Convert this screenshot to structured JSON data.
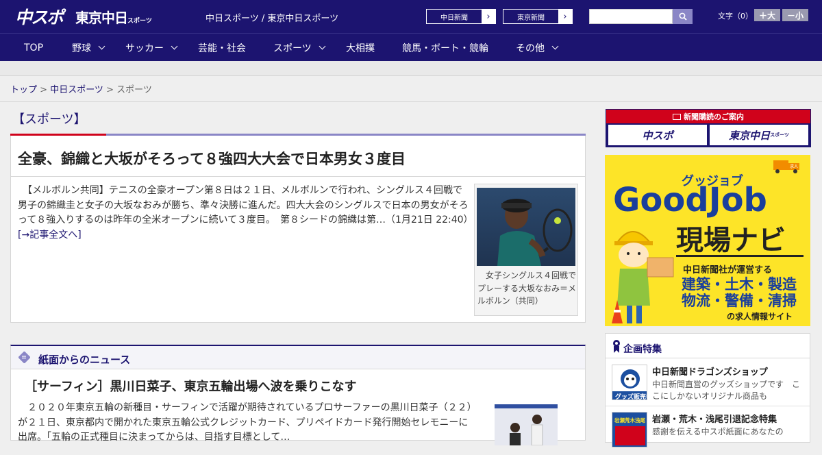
{
  "header": {
    "logo_main": "中スポ",
    "logo_sub": "東京中日",
    "logo_sub_small": "スポーツ",
    "site_title": "中日スポーツ / 東京中日スポーツ",
    "ext_links": [
      {
        "label": "中日新聞"
      },
      {
        "label": "東京新聞"
      }
    ],
    "search": {
      "placeholder": "",
      "value": ""
    },
    "fontsize": {
      "label": "文字（0）",
      "larger": "＋大",
      "smaller": "－小"
    }
  },
  "nav": {
    "items": [
      {
        "label": "TOP",
        "dropdown": false
      },
      {
        "label": "野球",
        "dropdown": true
      },
      {
        "label": "サッカー",
        "dropdown": true
      },
      {
        "label": "芸能・社会",
        "dropdown": false
      },
      {
        "label": "スポーツ",
        "dropdown": true
      },
      {
        "label": "大相撲",
        "dropdown": false
      },
      {
        "label": "競馬・ボート・競輪",
        "dropdown": false
      },
      {
        "label": "その他",
        "dropdown": true
      }
    ]
  },
  "breadcrumb": {
    "top": "トップ",
    "sep": " > ",
    "second": "中日スポーツ",
    "current": "スポーツ"
  },
  "main": {
    "section_title": "【スポーツ】",
    "lead": {
      "headline": "全豪、錦織と大坂がそろって８強四大大会で日本男女３度目",
      "body": "　【メルボルン共同】テニスの全豪オープン第８日は２１日、メルボルンで行われ、シングルス４回戦で男子の錦織圭と女子の大坂なおみが勝ち、準々決勝に進んだ。四大大会のシングルスで日本の男女がそろって８強入りするのは昨年の全米オープンに続いて３度目。　第８シードの錦織は第…（1月21日 22:40）　",
      "more": "[→記事全文へ]",
      "caption": "　女子シングルス４回戦でプレーする大坂なおみ＝メルボルン（共同）"
    },
    "news": {
      "section_title": "紙面からのニュース",
      "headline": "［サーフィン］黒川日菜子、東京五輪出場へ波を乗りこなす",
      "body": "　２０２０年東京五輪の新種目・サーフィンで活躍が期待されているプロサーファーの黒川日菜子（２２）が２１日、東京都内で開かれた東京五輪公式クレジットカード、プリペイドカード発行開始セレモニーに出席。「五輪の正式種目に決まってからは、目指す目標として…"
    }
  },
  "sidebar": {
    "subscribe": {
      "title": "新聞購読のご案内",
      "logo1": "中スポ",
      "logo2": "東京中日",
      "logo2_small": "スポーツ"
    },
    "ad": {
      "ruby": "グッジョブ",
      "brand": "GoodJob",
      "product": "現場ナビ",
      "line1": "中日新聞社が運営する",
      "line2": "建築・土木・製造",
      "line3": "物流・警備・清掃",
      "line4": "の求人情報サイト",
      "badge": "求人"
    },
    "special": {
      "title": "企画特集",
      "items": [
        {
          "title": "中日新聞ドラゴンズショップ",
          "desc": "中日新聞直営のグッズショップです　ここにしかないオリジナル商品も",
          "thumb_text": "グッズ販売中"
        },
        {
          "title": "岩瀬・荒木・浅尾引退記念特集",
          "desc": "感謝を伝える中スポ紙面にあなたの",
          "thumb_text": "岩瀬荒木浅尾"
        }
      ]
    }
  },
  "colors": {
    "brand_navy": "#1c1470",
    "accent_red": "#d0021b",
    "accent_purple": "#8a86c6",
    "ad_yellow": "#fde428"
  }
}
